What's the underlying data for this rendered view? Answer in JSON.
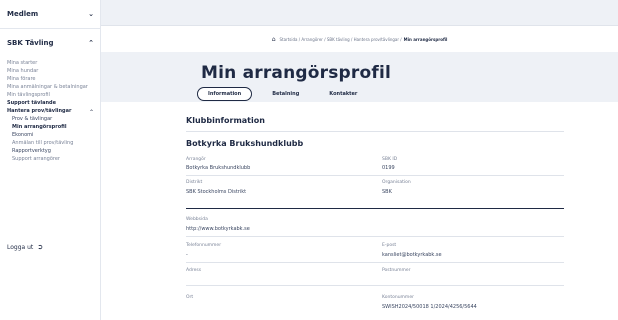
{
  "sidebar": {
    "section1_label": "Medlem",
    "section2_label": "SBK Tävling",
    "items": [
      {
        "label": "Mina starter"
      },
      {
        "label": "Mina hundar"
      },
      {
        "label": "Mina förare"
      },
      {
        "label": "Mina anmälningar & betalningar"
      },
      {
        "label": "Min tävlingsprofil"
      },
      {
        "label": "Support tävlande"
      }
    ],
    "manage_label": "Hantera prov/tävlingar",
    "manage_items": [
      {
        "label": "Prov & tävlingar"
      },
      {
        "label": "Min arrangörsprofil"
      },
      {
        "label": "Ekonomi"
      },
      {
        "label": "Anmälan till prov/tävling"
      },
      {
        "label": "Rapportverktyg"
      },
      {
        "label": "Support arrangörer"
      }
    ],
    "logout_label": "Logga ut"
  },
  "breadcrumb": {
    "path": "Startsida / Arrangörer / SBK tävling / Hantera prov/tävlingar /",
    "current": "Min arrangörsprofil"
  },
  "header": {
    "title": "Min arrangörsprofil",
    "tabs": [
      {
        "label": "Information"
      },
      {
        "label": "Betalning"
      },
      {
        "label": "Kontakter"
      }
    ]
  },
  "club": {
    "section_title": "Klubbinformation",
    "name": "Botkyrka Brukshundklubb",
    "fields": {
      "arranger_label": "Arrangör",
      "arranger_value": "Botkyrka Brukshundklubb",
      "sbk_id_label": "SBK ID",
      "sbk_id_value": "0199",
      "district_label": "Distrikt",
      "district_value": "SBK Stockholms Distrikt",
      "org_label": "Organisation",
      "org_value": "SBK",
      "website_label": "Webbsida",
      "website_value": "http://www.botkyrkabk.se",
      "phone_label": "Telefonnummer",
      "phone_value": "-",
      "email_label": "E-post",
      "email_value": "kansliet@botkyrkabk.se",
      "address_label": "Adress",
      "address_value": "",
      "postcode_label": "Postnummer",
      "postcode_value": "",
      "city_label": "Ort",
      "city_value": "",
      "account_label": "Kontonummer",
      "account_value": "SWISH2024/50018 1/2024/4256/5644"
    }
  }
}
